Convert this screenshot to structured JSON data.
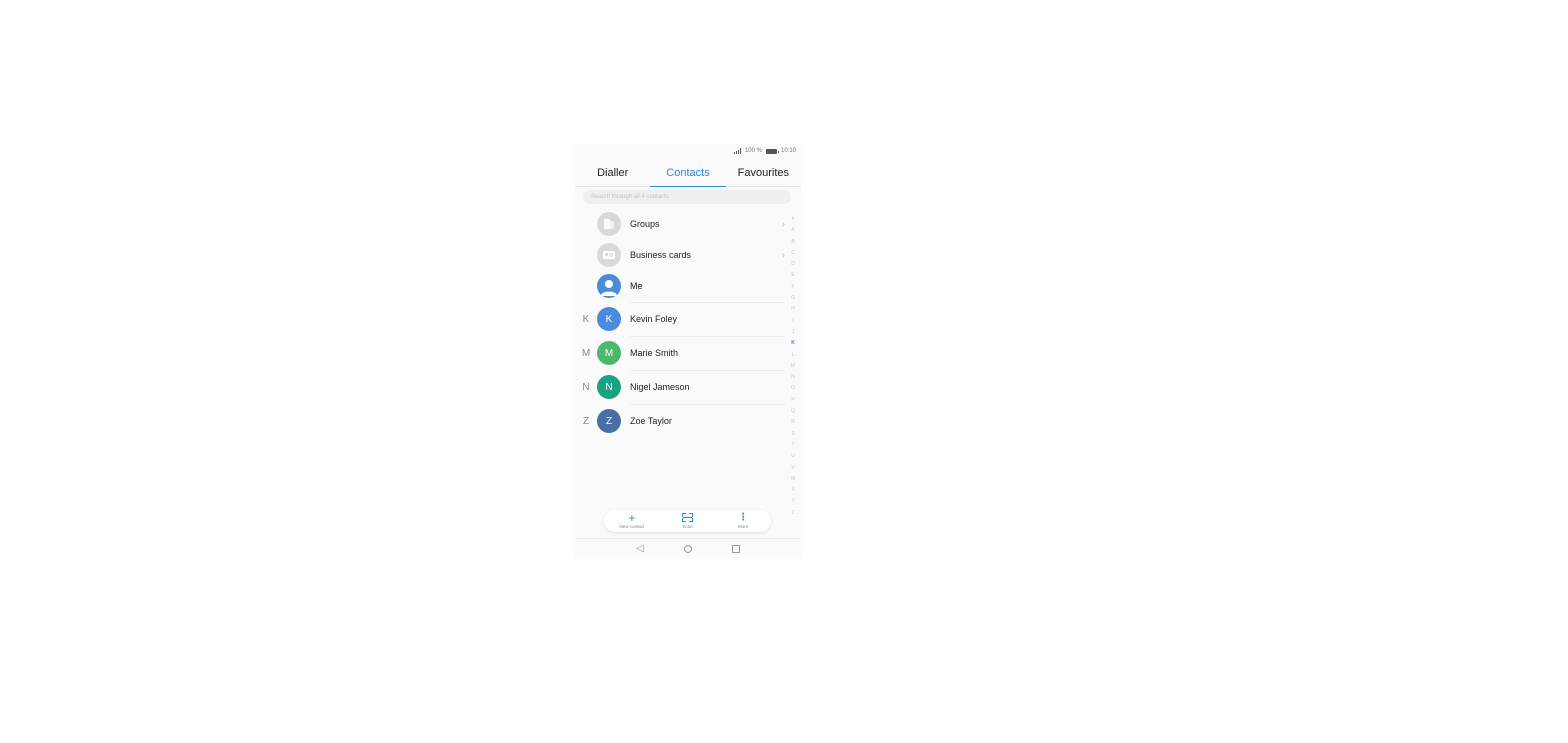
{
  "status_bar": {
    "battery": "100 %",
    "time": "10:10"
  },
  "tabs": [
    {
      "label": "Dialler"
    },
    {
      "label": "Contacts"
    },
    {
      "label": "Favourites"
    }
  ],
  "search": {
    "placeholder": "Search through all 4 contacts"
  },
  "special_rows": [
    {
      "label": "Groups",
      "icon": "groups-icon"
    },
    {
      "label": "Business cards",
      "icon": "business-card-icon"
    },
    {
      "label": "Me",
      "icon": "person-icon"
    }
  ],
  "contacts": [
    {
      "section": "K",
      "initial": "K",
      "name": "Kevin Foley",
      "color": "#4a8cdb"
    },
    {
      "section": "M",
      "initial": "M",
      "name": "Marie Smith",
      "color": "#4cb86e"
    },
    {
      "section": "N",
      "initial": "N",
      "name": "Nigel Jameson",
      "color": "#1aa383"
    },
    {
      "section": "Z",
      "initial": "Z",
      "name": "Zoe Taylor",
      "color": "#4a6fa5"
    }
  ],
  "alphabet_index": [
    "#",
    "A",
    "B",
    "C",
    "D",
    "E",
    "F",
    "G",
    "H",
    "I",
    "J",
    "K",
    "L",
    "M",
    "N",
    "O",
    "P",
    "Q",
    "R",
    "S",
    "T",
    "U",
    "V",
    "W",
    "X",
    "Y",
    "Z"
  ],
  "alphabet_selected": "K",
  "actions": [
    {
      "label": "New contact",
      "icon": "plus-icon"
    },
    {
      "label": "Scan",
      "icon": "scan-icon"
    },
    {
      "label": "More",
      "icon": "more-vertical-icon"
    }
  ],
  "colors": {
    "accent": "#2a8be0",
    "me_avatar": "#4a8cdb",
    "placeholder_avatar": "#d0d0d0"
  }
}
